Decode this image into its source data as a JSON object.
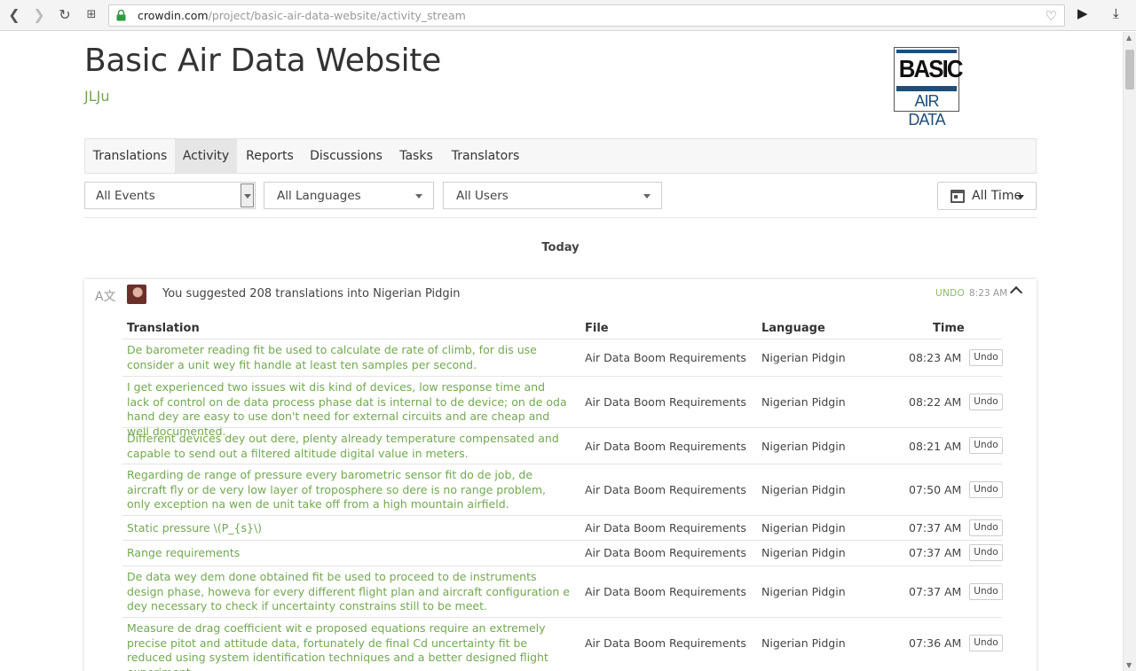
{
  "browser": {
    "url_host": "crowdin.com",
    "url_path": "/project/basic-air-data-website/activity_stream"
  },
  "project": {
    "title": "Basic Air Data Website",
    "owner": "JLJu",
    "logo_top": "BASIC",
    "logo_bottom": "AIR DATA"
  },
  "tabs": [
    {
      "label": "Translations"
    },
    {
      "label": "Activity"
    },
    {
      "label": "Reports"
    },
    {
      "label": "Discussions"
    },
    {
      "label": "Tasks"
    },
    {
      "label": "Translators"
    }
  ],
  "filters": {
    "events": "All Events",
    "languages": "All Languages",
    "users": "All Users",
    "time": "All Time"
  },
  "day_label": "Today",
  "activity": {
    "summary": "You suggested 208 translations into Nigerian Pidgin",
    "undo_label": "UNDO",
    "time": "8:23 AM",
    "columns": {
      "translation": "Translation",
      "file": "File",
      "language": "Language",
      "time": "Time"
    },
    "rows": [
      {
        "translation": "De barometer reading fit be used to calculate de rate of climb, for dis use consider a unit wey fit handle at least ten samples per second.",
        "file": "Air Data Boom Requirements",
        "language": "Nigerian Pidgin",
        "time": "08:23 AM",
        "undo": "Undo"
      },
      {
        "translation": "I get experienced two issues wit dis kind of devices, low response time and lack of control on de data process phase dat is internal to de device; on de oda hand dey are easy to use don't need for external circuits and are cheap and well documented.",
        "file": "Air Data Boom Requirements",
        "language": "Nigerian Pidgin",
        "time": "08:22 AM",
        "undo": "Undo"
      },
      {
        "translation": "Different devices dey out dere, plenty already temperature compensated and capable to send out a filtered altitude digital value in meters.",
        "file": "Air Data Boom Requirements",
        "language": "Nigerian Pidgin",
        "time": "08:21 AM",
        "undo": "Undo"
      },
      {
        "translation": "Regarding de range of pressure every barometric sensor fit do de job, de aircraft fly or de very low layer of troposphere so dere is no range problem, only exception na wen de unit take off from a high mountain airfield.",
        "file": "Air Data Boom Requirements",
        "language": "Nigerian Pidgin",
        "time": "07:50 AM",
        "undo": "Undo"
      },
      {
        "translation": "Static pressure \\(P_{s}\\)",
        "file": "Air Data Boom Requirements",
        "language": "Nigerian Pidgin",
        "time": "07:37 AM",
        "undo": "Undo"
      },
      {
        "translation": "Range requirements",
        "file": "Air Data Boom Requirements",
        "language": "Nigerian Pidgin",
        "time": "07:37 AM",
        "undo": "Undo"
      },
      {
        "translation": "De data wey dem done obtained fit be used to proceed to de instruments design phase, howeva for every different flight plan and aircraft configuration e dey necessary to check if uncertainty constrains still to be meet.",
        "file": "Air Data Boom Requirements",
        "language": "Nigerian Pidgin",
        "time": "07:37 AM",
        "undo": "Undo"
      },
      {
        "translation": "Measure de drag coefficient wit e proposed equations require an extremely precise pitot and attitude data, fortunately de final Cd uncertainty fit be reduced using system identification techniques and a better designed flight experiment.",
        "file": "Air Data Boom Requirements",
        "language": "Nigerian Pidgin",
        "time": "07:36 AM",
        "undo": "Undo"
      }
    ]
  },
  "colors": {
    "accent_green": "#72a851",
    "logo_blue": "#1f4e79"
  }
}
